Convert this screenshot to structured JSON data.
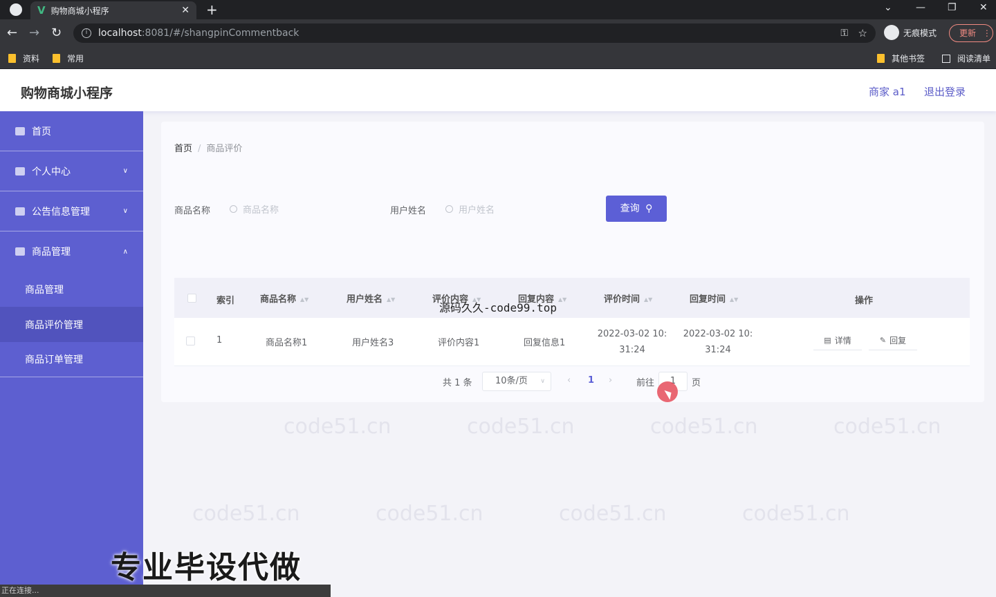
{
  "browser": {
    "tab_title": "购物商城小程序",
    "url_host": "localhost",
    "url_path": ":8081/#/shangpinCommentback",
    "incognito_label": "无痕模式",
    "update_label": "更新",
    "bookmarks": [
      "资料",
      "常用"
    ],
    "bookmarks_right": [
      "其他书签",
      "阅读清单"
    ],
    "status": "正在连接..."
  },
  "header": {
    "brand": "购物商城小程序",
    "user": "商家 a1",
    "logout": "退出登录"
  },
  "sidebar": {
    "items": [
      {
        "label": "首页"
      },
      {
        "label": "个人中心"
      },
      {
        "label": "公告信息管理"
      },
      {
        "label": "商品管理"
      }
    ],
    "sub_items": [
      {
        "label": "商品管理"
      },
      {
        "label": "商品评价管理"
      },
      {
        "label": "商品订单管理"
      }
    ]
  },
  "breadcrumb": {
    "home": "首页",
    "separator": "/",
    "current": "商品评价"
  },
  "filters": {
    "name_label": "商品名称",
    "name_placeholder": "商品名称",
    "user_label": "用户姓名",
    "user_placeholder": "用户姓名",
    "query_button": "查询"
  },
  "table": {
    "columns": [
      "索引",
      "商品名称",
      "用户姓名",
      "评价内容",
      "回复内容",
      "评价时间",
      "回复时间",
      "操作"
    ],
    "rows": [
      {
        "index": "1",
        "product": "商品名称1",
        "user": "用户姓名3",
        "comment": "评价内容1",
        "reply": "回复信息1",
        "comment_time_1": "2022-03-02 10:",
        "comment_time_2": "31:24",
        "reply_time_1": "2022-03-02 10:",
        "reply_time_2": "31:24",
        "detail": "详情",
        "reply_btn": "回复"
      }
    ]
  },
  "pagination": {
    "total": "共 1 条",
    "page_size": "10条/页",
    "prev": "‹",
    "current": "1",
    "next": "›",
    "goto": "前往",
    "goto_value": "1",
    "page_unit": "页"
  },
  "overlay": {
    "source_text": "源码久久-code99.top",
    "promo": "专业毕设代做",
    "watermark": "code51.cn"
  }
}
